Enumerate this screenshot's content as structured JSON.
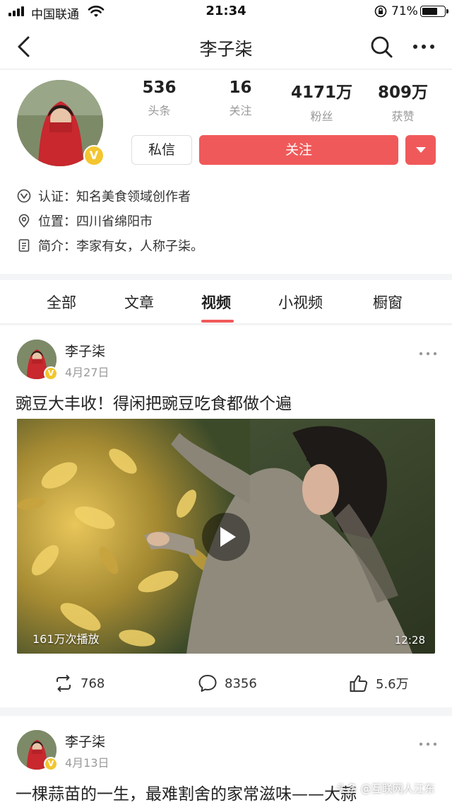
{
  "status_bar": {
    "carrier": "中国联通",
    "time": "21:34",
    "battery_percent": "71%",
    "battery_level": 0.71
  },
  "nav": {
    "title": "李子柒"
  },
  "profile": {
    "stats": [
      {
        "value": "536",
        "label": "头条"
      },
      {
        "value": "16",
        "label": "关注"
      },
      {
        "value": "4171万",
        "label": "粉丝"
      },
      {
        "value": "809万",
        "label": "获赞"
      }
    ],
    "message_button": "私信",
    "follow_button": "关注",
    "verify_label": "认证：",
    "verify_text": "知名美食领域创作者",
    "location_label": "位置：",
    "location_text": "四川省绵阳市",
    "intro_label": "简介：",
    "intro_text": "李家有女，人称子柒。"
  },
  "tabs": [
    "全部",
    "文章",
    "视频",
    "小视频",
    "橱窗"
  ],
  "active_tab": "视频",
  "posts": [
    {
      "author": "李子柒",
      "date": "4月27日",
      "title": "豌豆大丰收！得闲把豌豆吃食都做个遍",
      "views": "161万次播放",
      "duration": "12:28",
      "shares": "768",
      "comments": "8356",
      "likes": "5.6万"
    },
    {
      "author": "李子柒",
      "date": "4月13日",
      "title": "一棵蒜苗的一生，最难割舍的家常滋味——大蒜"
    }
  ],
  "watermark": "头条 @互联网人江东",
  "colors": {
    "accent": "#f0595a",
    "verify_badge": "#f3c630"
  }
}
